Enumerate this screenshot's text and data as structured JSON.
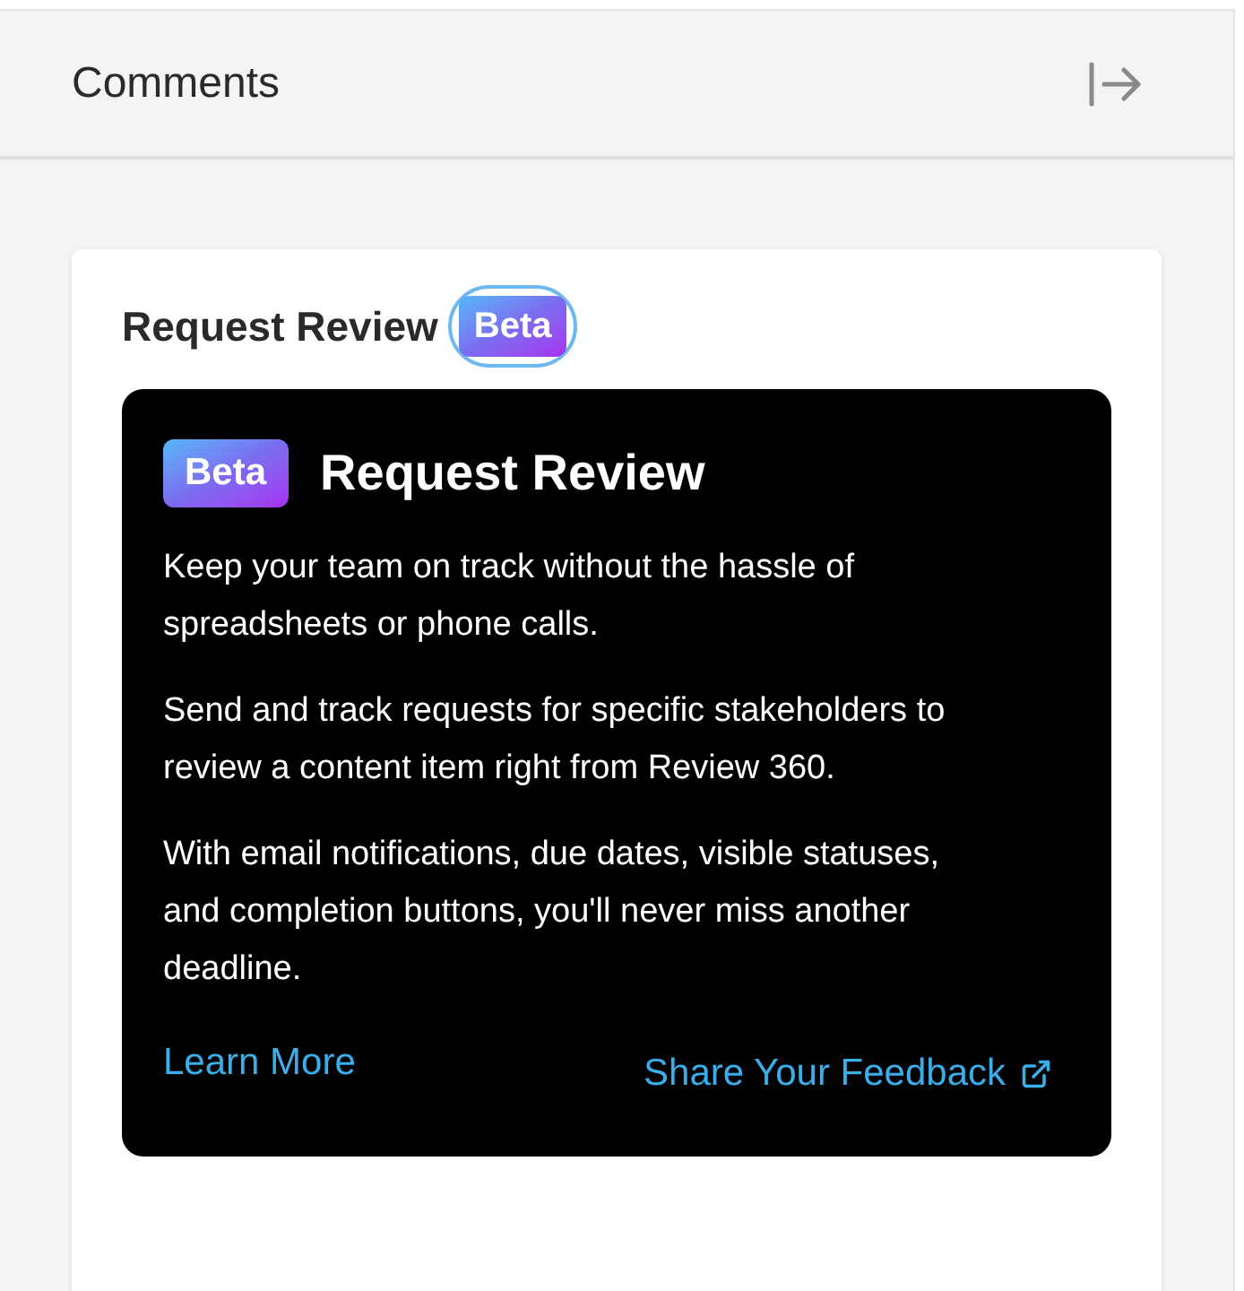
{
  "panel": {
    "title": "Comments"
  },
  "card": {
    "heading": "Request Review",
    "badge": {
      "label": "Beta",
      "focused": true
    }
  },
  "popover": {
    "badge": "Beta",
    "title": "Request Review",
    "paragraphs": [
      "Keep your team on track without the hassle of spreadsheets or phone calls.",
      "Send and track requests for specific stakeholders to review a content item right from Review 360.",
      "With email notifications, due dates, visible statuses, and completion buttons, you'll never miss another deadline."
    ],
    "links": [
      {
        "label": "Learn More",
        "external": false
      },
      {
        "label": "Share Your Feedback",
        "external": true
      }
    ]
  }
}
